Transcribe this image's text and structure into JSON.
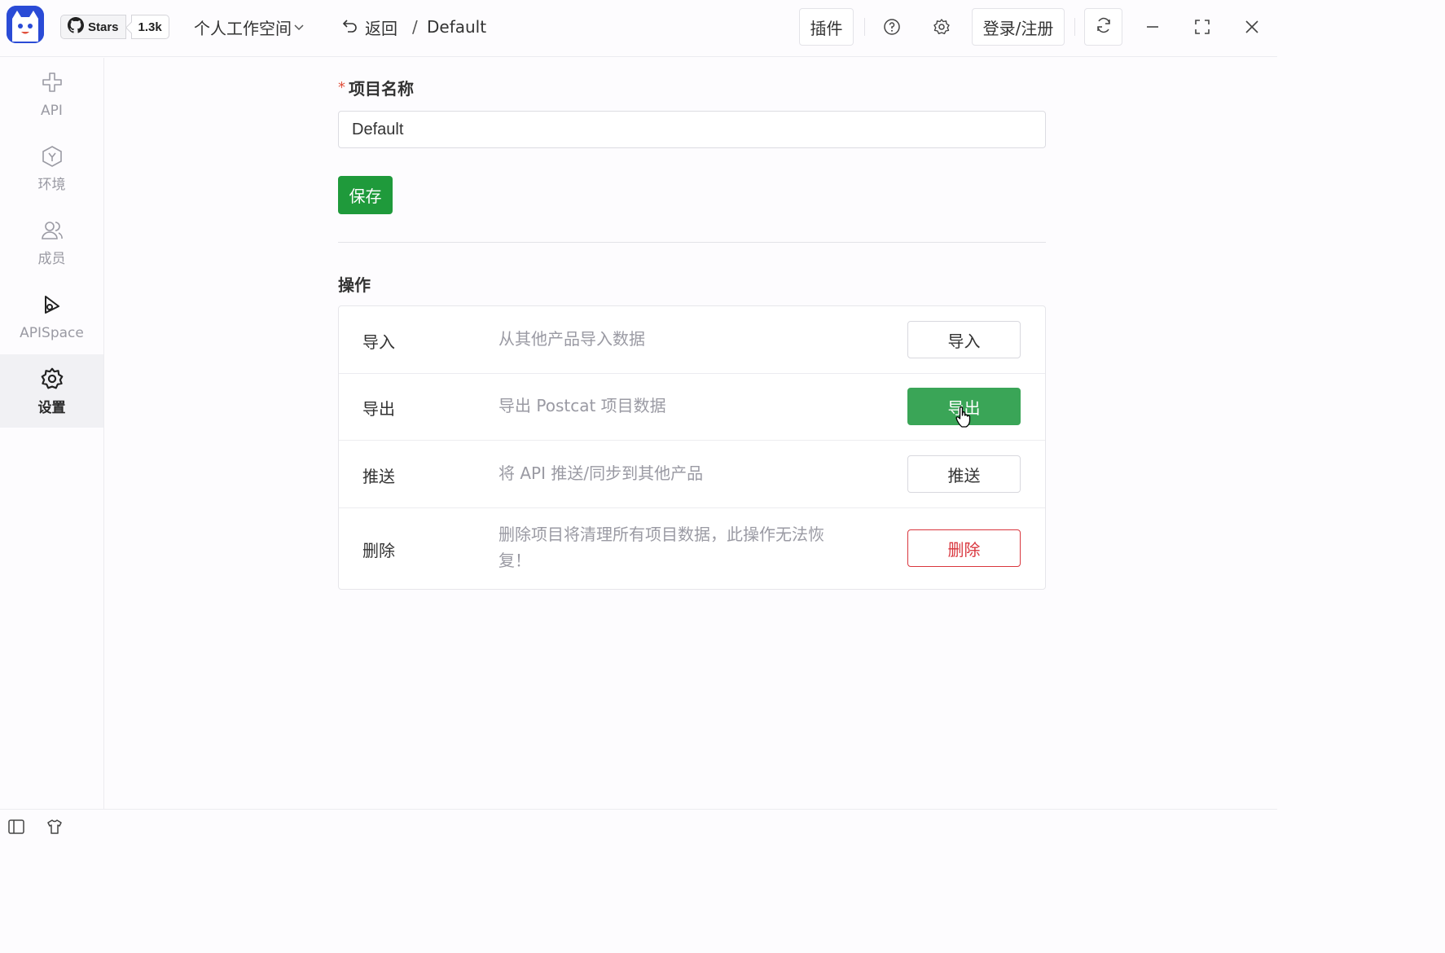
{
  "header": {
    "github": {
      "stars_label": "Stars",
      "stars_count": "1.3k"
    },
    "workspace_label": "个人工作空间",
    "back_label": "返回",
    "breadcrumb_sep": "/",
    "breadcrumb_current": "Default",
    "plugins_label": "插件",
    "login_label": "登录/注册"
  },
  "sidebar": {
    "items": [
      {
        "label": "API",
        "icon": "api-icon",
        "active": false
      },
      {
        "label": "环境",
        "icon": "environment-icon",
        "active": false
      },
      {
        "label": "成员",
        "icon": "members-icon",
        "active": false
      },
      {
        "label": "APISpace",
        "icon": "apispace-icon",
        "active": false
      },
      {
        "label": "设置",
        "icon": "gear-icon",
        "active": true
      }
    ]
  },
  "project": {
    "required_mark": "*",
    "name_label": "项目名称",
    "name_value": "Default",
    "save_label": "保存"
  },
  "operations": {
    "title": "操作",
    "rows": [
      {
        "name": "导入",
        "desc": "从其他产品导入数据",
        "button": "导入",
        "style": "default"
      },
      {
        "name": "导出",
        "desc": "导出 Postcat 项目数据",
        "button": "导出",
        "style": "primary"
      },
      {
        "name": "推送",
        "desc": "将 API 推送/同步到其他产品",
        "button": "推送",
        "style": "default"
      },
      {
        "name": "删除",
        "desc": "删除项目将清理所有项目数据，此操作无法恢复！",
        "button": "删除",
        "style": "danger"
      }
    ]
  },
  "colors": {
    "primary": "#1f9a3b",
    "danger": "#d9363e",
    "brand": "#2a4bd6"
  }
}
